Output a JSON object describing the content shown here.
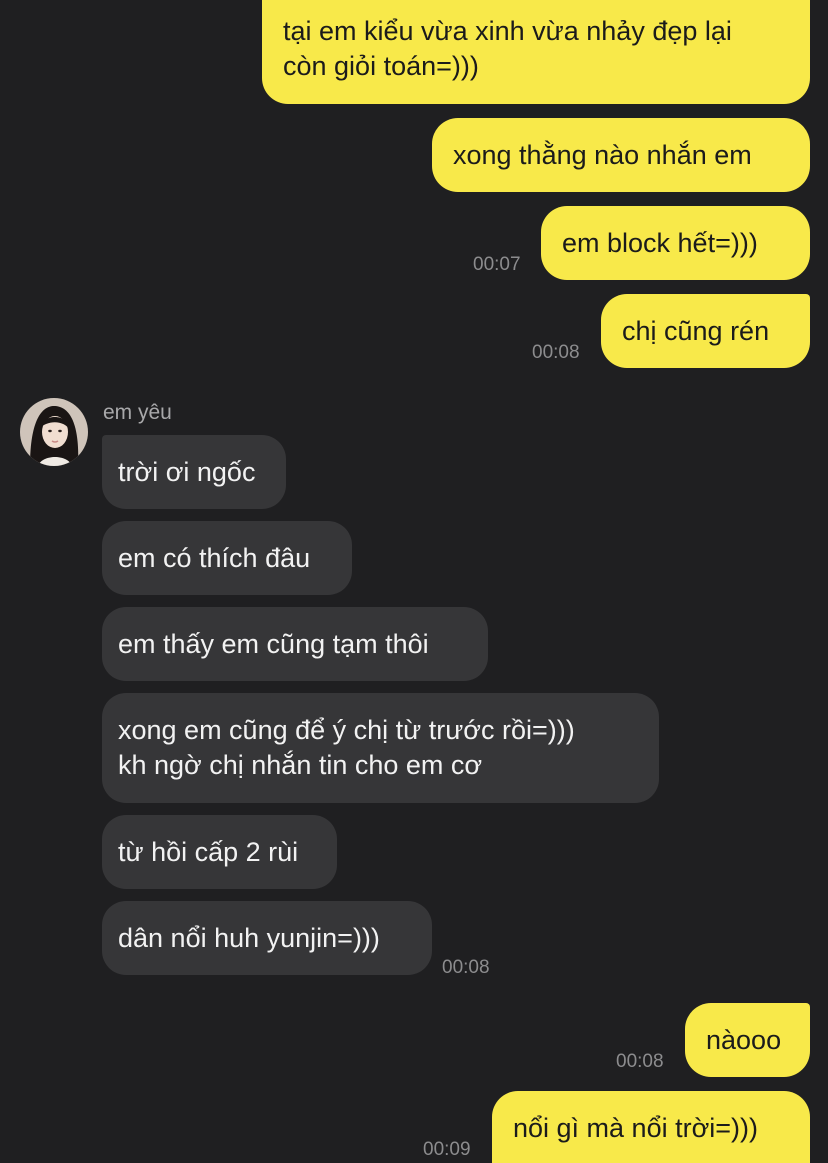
{
  "colors": {
    "background": "#1f1f21",
    "outgoing_bubble": "#f8e94a",
    "incoming_bubble": "#363638",
    "timestamp": "#8c8c8e"
  },
  "contact": {
    "name": "em yêu",
    "avatar_icon": "profile-photo"
  },
  "messages": [
    {
      "from": "me",
      "lines": [
        "tại em kiểu vừa xinh vừa nhảy đẹp lại",
        "còn giỏi toán=)))"
      ],
      "time": ""
    },
    {
      "from": "me",
      "lines": [
        "xong thằng nào nhắn em"
      ],
      "time": ""
    },
    {
      "from": "me",
      "lines": [
        "em block hết=)))"
      ],
      "time": "00:07"
    },
    {
      "from": "me",
      "lines": [
        "chị cũng rén"
      ],
      "time": "00:08"
    },
    {
      "from": "them",
      "lines": [
        "trời ơi ngốc"
      ],
      "time": ""
    },
    {
      "from": "them",
      "lines": [
        "em có thích đâu"
      ],
      "time": ""
    },
    {
      "from": "them",
      "lines": [
        "em thấy em cũng tạm thôi"
      ],
      "time": ""
    },
    {
      "from": "them",
      "lines": [
        "xong em cũng để ý chị từ trước rồi=)))",
        "kh ngờ chị nhắn tin cho em cơ"
      ],
      "time": ""
    },
    {
      "from": "them",
      "lines": [
        "từ hồi cấp 2 rùi"
      ],
      "time": ""
    },
    {
      "from": "them",
      "lines": [
        "dân nổi huh yunjin=)))"
      ],
      "time": "00:08"
    },
    {
      "from": "me",
      "lines": [
        "nàooo"
      ],
      "time": "00:08"
    },
    {
      "from": "me",
      "lines": [
        "nổi gì mà nổi trời=)))"
      ],
      "time": "00:09"
    }
  ]
}
